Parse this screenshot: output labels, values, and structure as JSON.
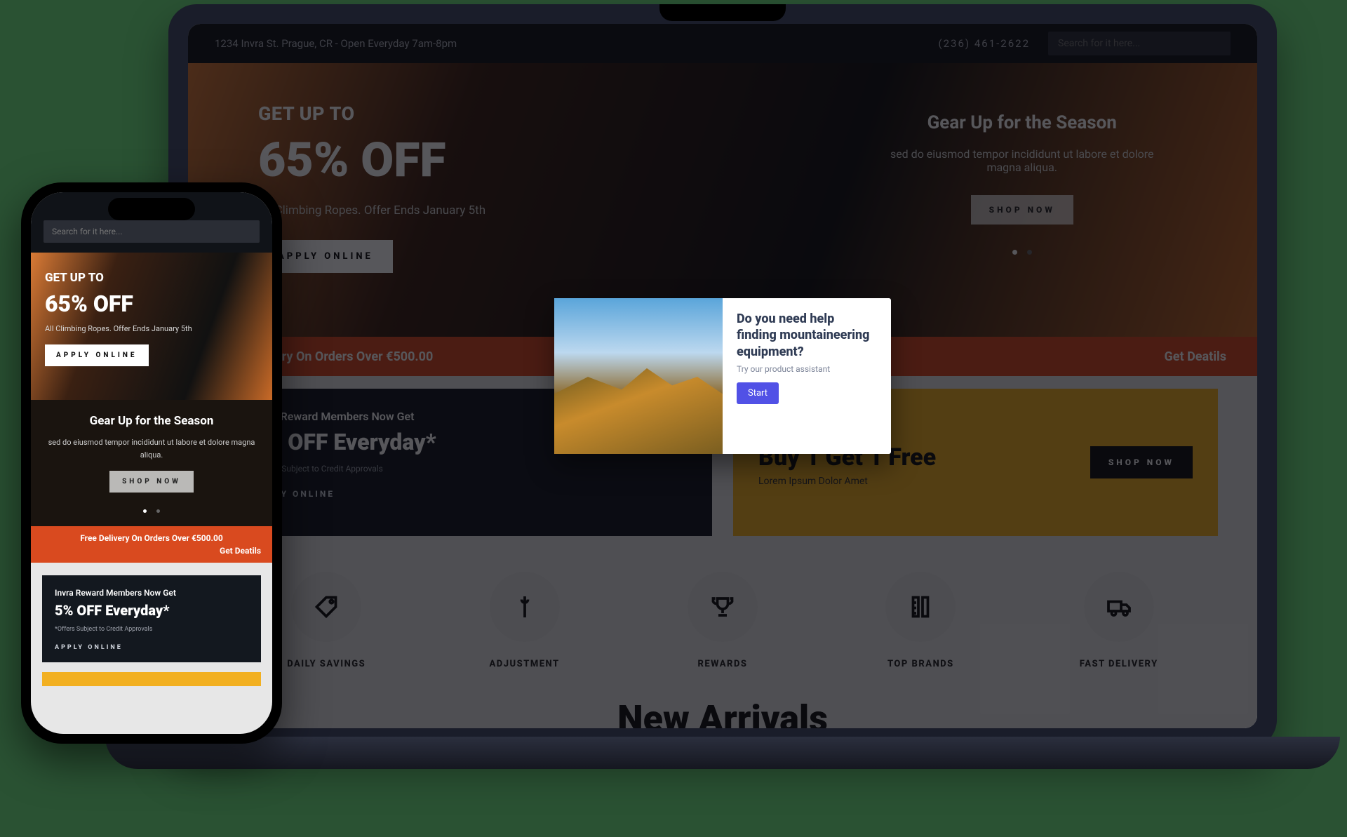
{
  "topbar": {
    "address": "1234 Invra St. Prague, CR - Open Everyday 7am-8pm",
    "phone": "(236) 461-2622",
    "search_placeholder": "Search for it here..."
  },
  "hero": {
    "kicker": "GET UP TO",
    "headline": "65% OFF",
    "subtext": "All Climbing Ropes. Offer Ends January 5th",
    "cta": "APPLY ONLINE",
    "season_title": "Gear Up for the Season",
    "season_text": "sed do eiusmod tempor incididunt ut labore et dolore magna aliqua.",
    "season_cta": "SHOP NOW"
  },
  "strip": {
    "text": "Free Delivery On Orders Over €500.00",
    "details_label": "Get Deatils"
  },
  "card1": {
    "line1": "Invra Reward Members Now Get",
    "line2": "5% OFF Everyday*",
    "fine": "*Offers Subject to Credit Approvals",
    "cta": "APPLY ONLINE"
  },
  "card2": {
    "title": "Buy 1 Get 1 Free",
    "text": "Lorem Ipsum Dolor Amet",
    "cta": "SHOP NOW"
  },
  "features": [
    {
      "label": "DAILY SAVINGS",
      "icon": "tag"
    },
    {
      "label": "ADJUSTMENT",
      "icon": "wrench"
    },
    {
      "label": "REWARDS",
      "icon": "trophy"
    },
    {
      "label": "TOP BRANDS",
      "icon": "ruler"
    },
    {
      "label": "FAST DELIVERY",
      "icon": "truck"
    }
  ],
  "new_arrivals": "New Arrivals",
  "modal": {
    "title": "Do you need help finding mountaineering equipment?",
    "subtitle": "Try our product assistant",
    "start": "Start"
  },
  "phone_strip": {
    "text": "Free Delivery On Orders Over €500.00",
    "details": "Get Deatils"
  }
}
